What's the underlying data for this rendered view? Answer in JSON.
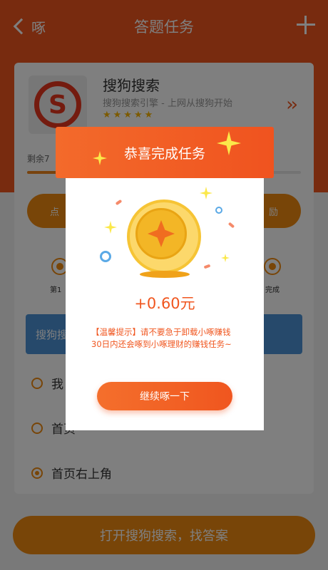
{
  "topbar": {
    "back_label": "啄",
    "title": "答题任务"
  },
  "app": {
    "name": "搜狗搜索",
    "description": "搜狗搜索引擎 - 上网从搜狗开始",
    "stars": "★★★★★",
    "rating": 5,
    "logo_letter": "S"
  },
  "progress": {
    "remaining_label": "剩余7",
    "fraction": 0.2
  },
  "steps": {
    "left_pill": "点",
    "right_pill": "励",
    "step1_label": "第1",
    "step2_label": "完成"
  },
  "question": {
    "text": "搜狗搜",
    "options": [
      {
        "label": "我",
        "selected": false
      },
      {
        "label": "首页",
        "selected": false
      },
      {
        "label": "首页右上角",
        "selected": true
      }
    ]
  },
  "bottom_button": "打开搜狗搜索，找答案",
  "modal": {
    "title": "恭喜完成任务",
    "reward": "+0.60元",
    "tip": "【温馨提示】请不要急于卸载小啄赚钱30日内还会啄到小啄理财的赚钱任务~",
    "continue_label": "继续啄一下"
  },
  "colors": {
    "brand_orange": "#f0561f",
    "accent_orange": "#f08a10",
    "question_blue": "#4c92d6",
    "coin_gold": "#f6c435"
  }
}
